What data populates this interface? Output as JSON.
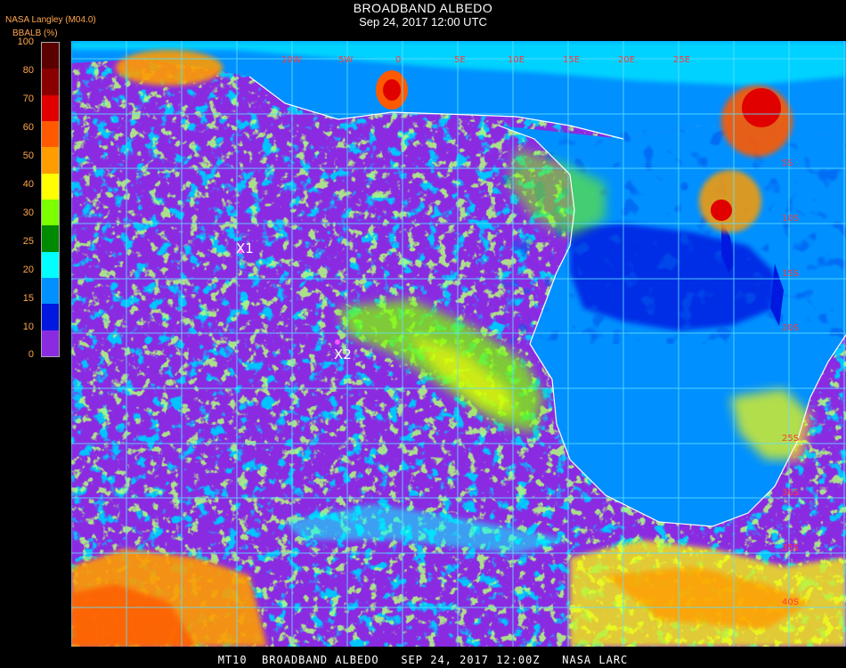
{
  "header": {
    "title": "BROADBAND ALBEDO",
    "subtitle": "Sep 24, 2017 12:00 UTC",
    "org": "NASA Langley (M04.0)",
    "unit": "BBALB (%)"
  },
  "colorbar": {
    "ticks": [
      "100",
      "80",
      "70",
      "60",
      "50",
      "40",
      "30",
      "25",
      "20",
      "15",
      "10",
      "0"
    ],
    "colors": [
      "#5a0000",
      "#8a0000",
      "#e00000",
      "#ff5a00",
      "#ff9c00",
      "#ffff00",
      "#7cff00",
      "#008a00",
      "#00ffff",
      "#0090ff",
      "#0018e0",
      "#8a2be2"
    ]
  },
  "map": {
    "markers": [
      {
        "label": "X1"
      },
      {
        "label": "X2"
      }
    ],
    "grid_labels": [
      "10W",
      "5W",
      "0",
      "5E",
      "10E",
      "15E",
      "20E",
      "25E",
      "5S",
      "10S",
      "15S",
      "20S",
      "25S",
      "30S",
      "35S",
      "40S"
    ],
    "colors": {
      "ocean": "#8a2be2",
      "land": "#0090ff",
      "grid": "#5fe0ff"
    }
  },
  "footer": {
    "text": "MT10  BROADBAND ALBEDO   SEP 24, 2017 12:00Z   NASA LARC"
  }
}
